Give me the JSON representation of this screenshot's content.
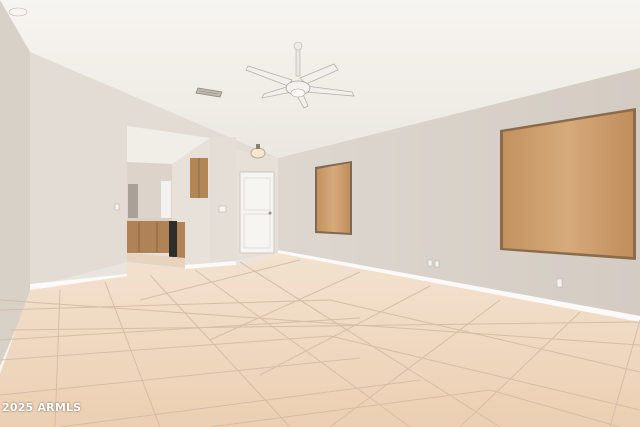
{
  "scene": {
    "subject": "empty-living-room-interior",
    "colors": {
      "ceiling": "#f4f1ec",
      "wall_left": "#ddd6cd",
      "wall_back": "#e3ddd5",
      "wall_right": "#d9d2ca",
      "floor_tile": "#efd9c2",
      "grout": "#d8c2ab",
      "blinds": "#c89a6c",
      "cabinets": "#b08356",
      "door": "#f7f6f3",
      "baseboard": "#fbfaf8"
    }
  },
  "watermark": {
    "text": "2025 ARMLS"
  }
}
